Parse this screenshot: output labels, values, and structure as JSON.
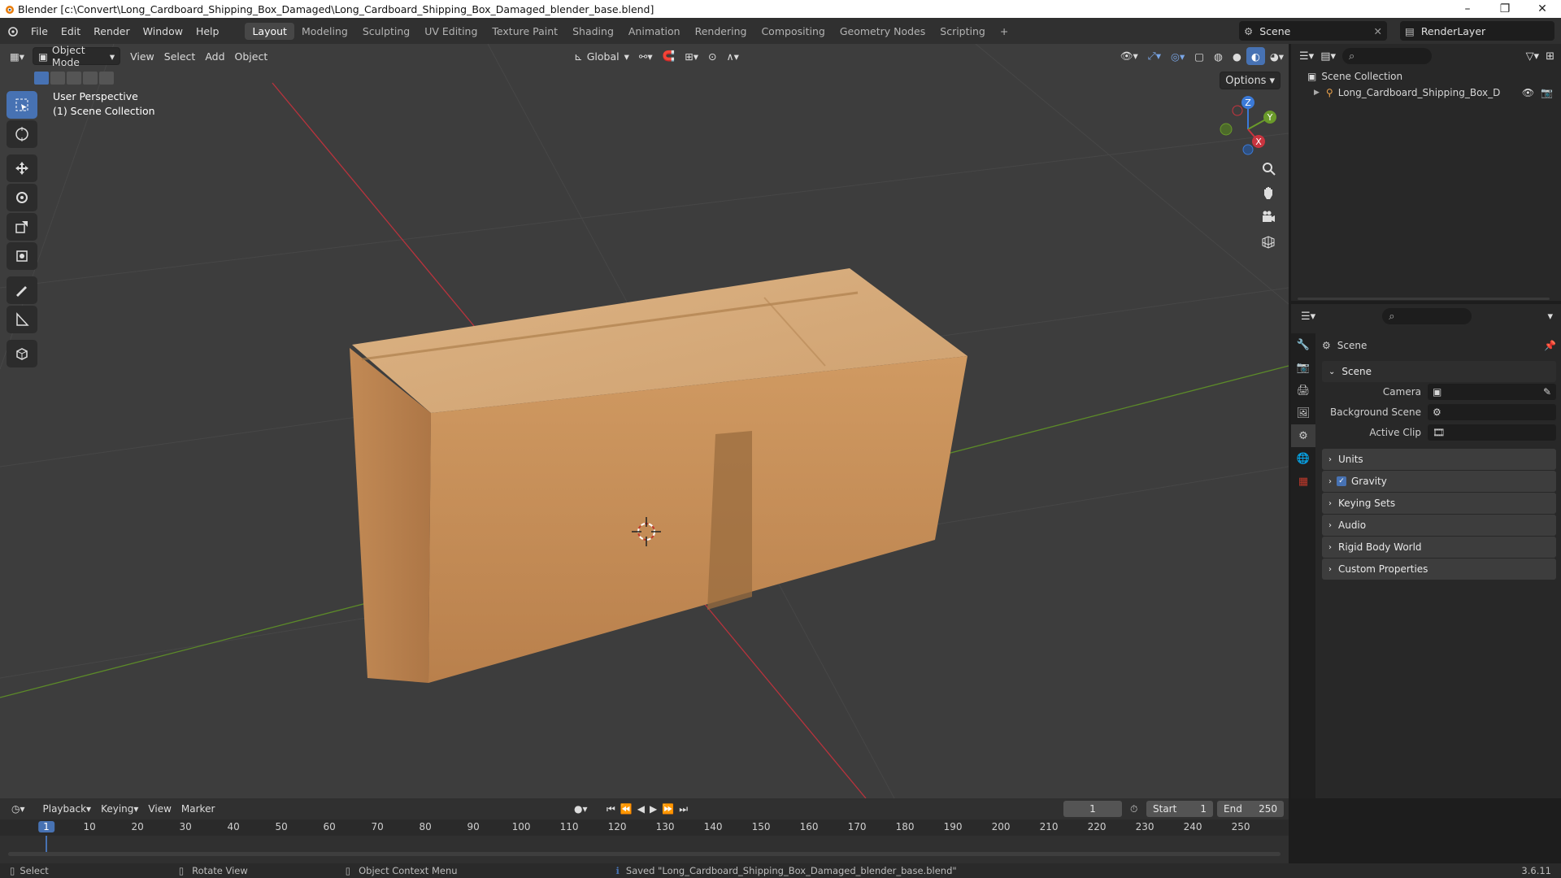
{
  "window": {
    "title": "Blender [c:\\Convert\\Long_Cardboard_Shipping_Box_Damaged\\Long_Cardboard_Shipping_Box_Damaged_blender_base.blend]",
    "min": "–",
    "max": "❐",
    "close": "✕"
  },
  "menus": [
    "File",
    "Edit",
    "Render",
    "Window",
    "Help"
  ],
  "workspaces": [
    "Layout",
    "Modeling",
    "Sculpting",
    "UV Editing",
    "Texture Paint",
    "Shading",
    "Animation",
    "Rendering",
    "Compositing",
    "Geometry Nodes",
    "Scripting",
    "+"
  ],
  "active_workspace": "Layout",
  "scene_name": "Scene",
  "render_layer": "RenderLayer",
  "viewport": {
    "mode": "Object Mode",
    "menus": [
      "View",
      "Select",
      "Add",
      "Object"
    ],
    "orientation": "Global",
    "options": "Options",
    "perspective": "User Perspective",
    "collection": "(1) Scene Collection",
    "gizmo": {
      "z": "Z",
      "y": "Y",
      "x": "X"
    }
  },
  "outliner": {
    "root": "Scene Collection",
    "item": "Long_Cardboard_Shipping_Box_Damage"
  },
  "properties": {
    "header": "Scene",
    "section": "Scene",
    "fields": [
      {
        "label": "Camera",
        "value": ""
      },
      {
        "label": "Background Scene",
        "value": ""
      },
      {
        "label": "Active Clip",
        "value": ""
      }
    ],
    "panels": [
      "Units",
      "Gravity",
      "Keying Sets",
      "Audio",
      "Rigid Body World",
      "Custom Properties"
    ],
    "gravity_enabled": true
  },
  "timeline": {
    "menus": [
      "Playback",
      "Keying",
      "View",
      "Marker"
    ],
    "current_frame": "1",
    "start_label": "Start",
    "start": "1",
    "end_label": "End",
    "end": "250",
    "ticks": [
      "1",
      "10",
      "20",
      "30",
      "40",
      "50",
      "60",
      "70",
      "80",
      "90",
      "100",
      "110",
      "120",
      "130",
      "140",
      "150",
      "160",
      "170",
      "180",
      "190",
      "200",
      "210",
      "220",
      "230",
      "240",
      "250"
    ]
  },
  "status": {
    "select": "Select",
    "rotate": "Rotate View",
    "context": "Object Context Menu",
    "message": "Saved \"Long_Cardboard_Shipping_Box_Damaged_blender_base.blend\"",
    "version": "3.6.11"
  },
  "colors": {
    "accent": "#4772b3",
    "x_axis": "#c9343f",
    "y_axis": "#6a9a2a",
    "z_axis": "#3b7ad8",
    "box": "#c8955c"
  }
}
